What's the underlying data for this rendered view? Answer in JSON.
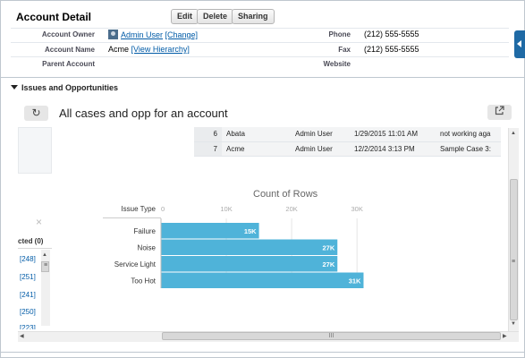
{
  "header": {
    "title": "Account Detail",
    "buttons": {
      "edit": "Edit",
      "delete": "Delete",
      "sharing": "Sharing"
    }
  },
  "fields": {
    "account_owner": {
      "label": "Account Owner",
      "value": "Admin User",
      "link": "[Change]"
    },
    "phone": {
      "label": "Phone",
      "value": "(212) 555-5555"
    },
    "account_name": {
      "label": "Account Name",
      "value": "Acme",
      "link": "[View Hierarchy]"
    },
    "fax": {
      "label": "Fax",
      "value": "(212) 555-5555"
    },
    "parent_account": {
      "label": "Parent Account",
      "value": ""
    },
    "website": {
      "label": "Website",
      "value": ""
    }
  },
  "section": {
    "title": "Issues and Opportunities"
  },
  "dashboard": {
    "title": "All cases and opp for an account",
    "refresh_icon": "refresh-icon",
    "expand_icon": "external-link-icon"
  },
  "cases_table": {
    "rows": [
      {
        "num": "6",
        "account": "Abata",
        "owner": "Admin User",
        "date": "1/29/2015 11:01 AM",
        "subject": "not working aga"
      },
      {
        "num": "7",
        "account": "Acme",
        "owner": "Admin User",
        "date": "12/2/2014 3:13 PM",
        "subject": "Sample Case 3:"
      }
    ]
  },
  "filter_panel": {
    "close": "×",
    "header": "cted (0)",
    "items": [
      "[248]",
      "[251]",
      "[241]",
      "[250]",
      "[223]"
    ]
  },
  "scrollbar": {
    "grip": "III",
    "vgrip": "≡"
  },
  "chart_data": {
    "type": "bar",
    "orientation": "horizontal",
    "title": "Count of Rows",
    "ylabel": "Issue Type",
    "categories": [
      "Failure",
      "Noise",
      "Service Light",
      "Too Hot"
    ],
    "values": [
      15000,
      27000,
      27000,
      31000
    ],
    "value_labels": [
      "15K",
      "27K",
      "27K",
      "31K"
    ],
    "xticks": [
      0,
      10000,
      20000,
      30000
    ],
    "xtick_labels": [
      "0",
      "10K",
      "20K",
      "30K"
    ],
    "xlim": [
      0,
      36000
    ],
    "grid": true,
    "bar_color": "#4fb3d9"
  },
  "colors": {
    "link": "#015ba7",
    "side_tab": "#1f6aa5"
  }
}
